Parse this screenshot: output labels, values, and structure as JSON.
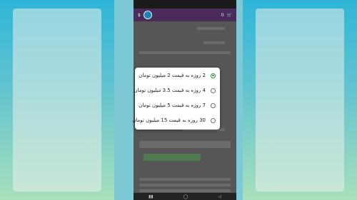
{
  "header": {
    "cart_count": "0"
  },
  "dialog": {
    "options": [
      {
        "label": "2 روزه به قیمت 2 میلیون تومان",
        "selected": true
      },
      {
        "label": "4 روزه به قیمت 3.5 میلیون تومان",
        "selected": false
      },
      {
        "label": "7 روزه به قیمت 5 میلیون تومان",
        "selected": false
      },
      {
        "label": "30 روزه به قیمت 15 میلیون تومان",
        "selected": false
      }
    ]
  },
  "colors": {
    "header_bg": "#4a2b5a",
    "radio_selected": "#2e8b3a"
  }
}
